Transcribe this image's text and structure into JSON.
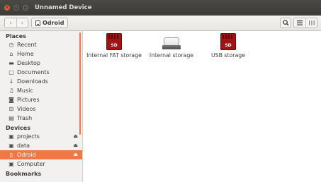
{
  "window": {
    "title": "Unnamed Device",
    "close_glyph": "×",
    "min_glyph": "–",
    "max_glyph": "□"
  },
  "toolbar": {
    "back_icon": "‹",
    "forward_icon": "›",
    "path_label": "Odroid",
    "search_icon": "⚲",
    "list_view_icon": "≡",
    "grid_view_icon": "⁞⁞⁞"
  },
  "sidebar": {
    "places_header": "Places",
    "places": [
      {
        "label": "Recent",
        "icon": "clock-icon",
        "glyph": "◷"
      },
      {
        "label": "Home",
        "icon": "home-icon",
        "glyph": "⌂"
      },
      {
        "label": "Desktop",
        "icon": "folder-icon",
        "glyph": "▬"
      },
      {
        "label": "Documents",
        "icon": "document-icon",
        "glyph": "▢"
      },
      {
        "label": "Downloads",
        "icon": "download-icon",
        "glyph": "↓"
      },
      {
        "label": "Music",
        "icon": "music-icon",
        "glyph": "♫"
      },
      {
        "label": "Pictures",
        "icon": "camera-icon",
        "glyph": "◙"
      },
      {
        "label": "Videos",
        "icon": "film-icon",
        "glyph": "⊟"
      },
      {
        "label": "Trash",
        "icon": "trash-icon",
        "glyph": "▤"
      }
    ],
    "devices_header": "Devices",
    "devices": [
      {
        "label": "projects",
        "icon": "drive-icon",
        "glyph": "▣",
        "eject": "⏏"
      },
      {
        "label": "data",
        "icon": "drive-icon",
        "glyph": "▣",
        "eject": "⏏"
      },
      {
        "label": "Odroid",
        "icon": "drive-icon",
        "glyph": "▯",
        "eject": "⏏"
      },
      {
        "label": "Computer",
        "icon": "computer-icon",
        "glyph": "▣"
      }
    ],
    "bookmarks_header": "Bookmarks",
    "accent_color": "#f07746"
  },
  "files": [
    {
      "label": "Internal FAT storage",
      "icon": "sd-card-icon",
      "badge": "SD"
    },
    {
      "label": "Internal storage",
      "icon": "hard-drive-icon"
    },
    {
      "label": "USB storage",
      "icon": "sd-card-icon",
      "badge": "SD"
    }
  ]
}
